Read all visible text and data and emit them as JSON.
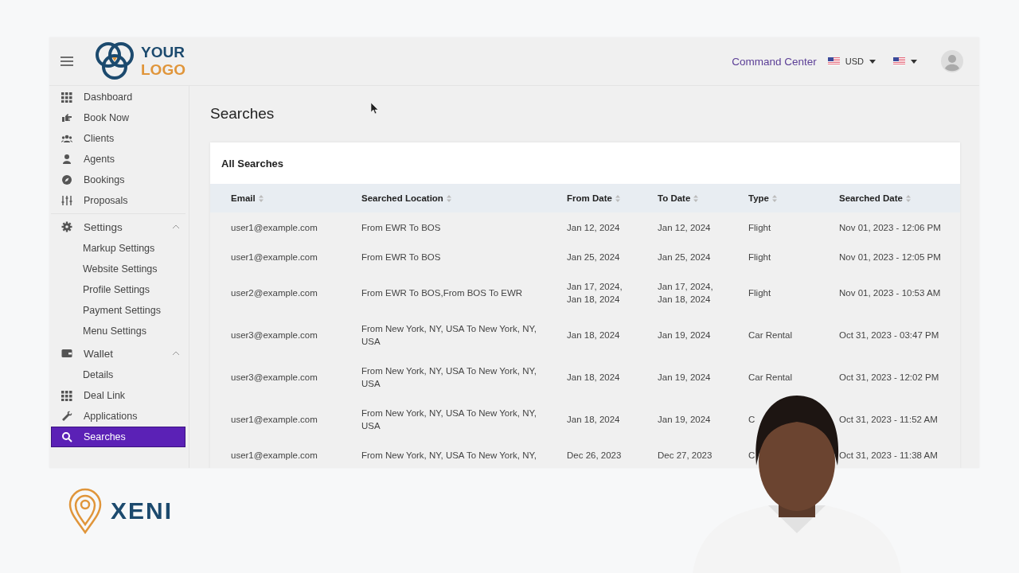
{
  "header": {
    "logo": {
      "line1": "YOUR",
      "line2": "LOGO"
    },
    "command_center": "Command Center",
    "currency": "USD"
  },
  "sidebar": {
    "items": [
      {
        "kind": "link",
        "label": "Dashboard",
        "selected": false
      },
      {
        "kind": "link",
        "label": "Book Now",
        "selected": false
      },
      {
        "kind": "link",
        "label": "Clients",
        "selected": false
      },
      {
        "kind": "link",
        "label": "Agents",
        "selected": false
      },
      {
        "kind": "link",
        "label": "Bookings",
        "selected": false
      },
      {
        "kind": "link",
        "label": "Proposals",
        "selected": false
      },
      {
        "kind": "group",
        "label": "Settings",
        "expanded": true,
        "children": [
          {
            "label": "Markup Settings",
            "selected": false
          },
          {
            "label": "Website Settings",
            "selected": false
          },
          {
            "label": "Profile Settings",
            "selected": false
          },
          {
            "label": "Payment Settings",
            "selected": false
          },
          {
            "label": "Menu Settings",
            "selected": false
          }
        ]
      },
      {
        "kind": "group",
        "label": "Wallet",
        "expanded": true,
        "children": [
          {
            "label": "Details",
            "selected": false
          }
        ]
      },
      {
        "kind": "link",
        "label": "Deal Link",
        "selected": false
      },
      {
        "kind": "link",
        "label": "Applications",
        "selected": false
      },
      {
        "kind": "link",
        "label": "Searches",
        "selected": true
      }
    ]
  },
  "page_title": "Searches",
  "card": {
    "title": "All Searches",
    "table": {
      "columns": [
        "Email",
        "Searched Location",
        "From Date",
        "To Date",
        "Type",
        "Searched Date"
      ],
      "rows": [
        {
          "email": "user1@example.com",
          "location": "From EWR To BOS",
          "from_date": [
            "Jan 12, 2024"
          ],
          "to_date": [
            "Jan 12, 2024"
          ],
          "type": "Flight",
          "searched_date": "Nov 01, 2023 - 12:06 PM"
        },
        {
          "email": "user1@example.com",
          "location": "From EWR To BOS",
          "from_date": [
            "Jan 25, 2024"
          ],
          "to_date": [
            "Jan 25, 2024"
          ],
          "type": "Flight",
          "searched_date": "Nov 01, 2023 - 12:05 PM"
        },
        {
          "email": "user2@example.com",
          "location": "From EWR To BOS,From BOS To EWR",
          "from_date": [
            "Jan 17, 2024,",
            "Jan 18, 2024"
          ],
          "to_date": [
            "Jan 17, 2024,",
            "Jan 18, 2024"
          ],
          "type": "Flight",
          "searched_date": "Nov 01, 2023 - 10:53 AM"
        },
        {
          "email": "user3@example.com",
          "location": "From New York, NY, USA To New York, NY, USA",
          "from_date": [
            "Jan 18, 2024"
          ],
          "to_date": [
            "Jan 19, 2024"
          ],
          "type": "Car Rental",
          "searched_date": "Oct 31, 2023 - 03:47 PM"
        },
        {
          "email": "user3@example.com",
          "location": "From New York, NY, USA To New York, NY, USA",
          "from_date": [
            "Jan 18, 2024"
          ],
          "to_date": [
            "Jan 19, 2024"
          ],
          "type": "Car Rental",
          "searched_date": "Oct 31, 2023 - 12:02 PM"
        },
        {
          "email": "user1@example.com",
          "location": "From New York, NY, USA To New York, NY, USA",
          "from_date": [
            "Jan 18, 2024"
          ],
          "to_date": [
            "Jan 19, 2024"
          ],
          "type": "C",
          "searched_date": "Oct 31, 2023 - 11:52 AM"
        },
        {
          "email": "user1@example.com",
          "location": "From New York, NY, USA To New York, NY,",
          "from_date": [
            "Dec 26, 2023"
          ],
          "to_date": [
            "Dec 27, 2023"
          ],
          "type": "C",
          "searched_date": "Oct 31, 2023 - 11:38 AM"
        }
      ]
    }
  },
  "brand": {
    "name": "XENI"
  }
}
